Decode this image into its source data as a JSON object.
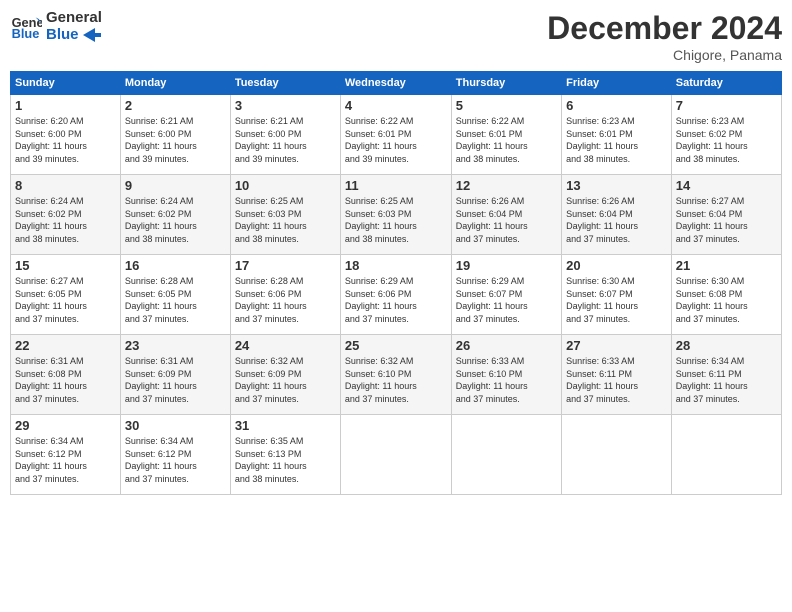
{
  "header": {
    "logo_line1": "General",
    "logo_line2": "Blue",
    "month": "December 2024",
    "location": "Chigore, Panama"
  },
  "days_of_week": [
    "Sunday",
    "Monday",
    "Tuesday",
    "Wednesday",
    "Thursday",
    "Friday",
    "Saturday"
  ],
  "weeks": [
    [
      {
        "day": "1",
        "sunrise": "6:20 AM",
        "sunset": "6:00 PM",
        "daylight": "11 hours and 39 minutes."
      },
      {
        "day": "2",
        "sunrise": "6:21 AM",
        "sunset": "6:00 PM",
        "daylight": "11 hours and 39 minutes."
      },
      {
        "day": "3",
        "sunrise": "6:21 AM",
        "sunset": "6:00 PM",
        "daylight": "11 hours and 39 minutes."
      },
      {
        "day": "4",
        "sunrise": "6:22 AM",
        "sunset": "6:01 PM",
        "daylight": "11 hours and 39 minutes."
      },
      {
        "day": "5",
        "sunrise": "6:22 AM",
        "sunset": "6:01 PM",
        "daylight": "11 hours and 38 minutes."
      },
      {
        "day": "6",
        "sunrise": "6:23 AM",
        "sunset": "6:01 PM",
        "daylight": "11 hours and 38 minutes."
      },
      {
        "day": "7",
        "sunrise": "6:23 AM",
        "sunset": "6:02 PM",
        "daylight": "11 hours and 38 minutes."
      }
    ],
    [
      {
        "day": "8",
        "sunrise": "6:24 AM",
        "sunset": "6:02 PM",
        "daylight": "11 hours and 38 minutes."
      },
      {
        "day": "9",
        "sunrise": "6:24 AM",
        "sunset": "6:02 PM",
        "daylight": "11 hours and 38 minutes."
      },
      {
        "day": "10",
        "sunrise": "6:25 AM",
        "sunset": "6:03 PM",
        "daylight": "11 hours and 38 minutes."
      },
      {
        "day": "11",
        "sunrise": "6:25 AM",
        "sunset": "6:03 PM",
        "daylight": "11 hours and 38 minutes."
      },
      {
        "day": "12",
        "sunrise": "6:26 AM",
        "sunset": "6:04 PM",
        "daylight": "11 hours and 37 minutes."
      },
      {
        "day": "13",
        "sunrise": "6:26 AM",
        "sunset": "6:04 PM",
        "daylight": "11 hours and 37 minutes."
      },
      {
        "day": "14",
        "sunrise": "6:27 AM",
        "sunset": "6:04 PM",
        "daylight": "11 hours and 37 minutes."
      }
    ],
    [
      {
        "day": "15",
        "sunrise": "6:27 AM",
        "sunset": "6:05 PM",
        "daylight": "11 hours and 37 minutes."
      },
      {
        "day": "16",
        "sunrise": "6:28 AM",
        "sunset": "6:05 PM",
        "daylight": "11 hours and 37 minutes."
      },
      {
        "day": "17",
        "sunrise": "6:28 AM",
        "sunset": "6:06 PM",
        "daylight": "11 hours and 37 minutes."
      },
      {
        "day": "18",
        "sunrise": "6:29 AM",
        "sunset": "6:06 PM",
        "daylight": "11 hours and 37 minutes."
      },
      {
        "day": "19",
        "sunrise": "6:29 AM",
        "sunset": "6:07 PM",
        "daylight": "11 hours and 37 minutes."
      },
      {
        "day": "20",
        "sunrise": "6:30 AM",
        "sunset": "6:07 PM",
        "daylight": "11 hours and 37 minutes."
      },
      {
        "day": "21",
        "sunrise": "6:30 AM",
        "sunset": "6:08 PM",
        "daylight": "11 hours and 37 minutes."
      }
    ],
    [
      {
        "day": "22",
        "sunrise": "6:31 AM",
        "sunset": "6:08 PM",
        "daylight": "11 hours and 37 minutes."
      },
      {
        "day": "23",
        "sunrise": "6:31 AM",
        "sunset": "6:09 PM",
        "daylight": "11 hours and 37 minutes."
      },
      {
        "day": "24",
        "sunrise": "6:32 AM",
        "sunset": "6:09 PM",
        "daylight": "11 hours and 37 minutes."
      },
      {
        "day": "25",
        "sunrise": "6:32 AM",
        "sunset": "6:10 PM",
        "daylight": "11 hours and 37 minutes."
      },
      {
        "day": "26",
        "sunrise": "6:33 AM",
        "sunset": "6:10 PM",
        "daylight": "11 hours and 37 minutes."
      },
      {
        "day": "27",
        "sunrise": "6:33 AM",
        "sunset": "6:11 PM",
        "daylight": "11 hours and 37 minutes."
      },
      {
        "day": "28",
        "sunrise": "6:34 AM",
        "sunset": "6:11 PM",
        "daylight": "11 hours and 37 minutes."
      }
    ],
    [
      {
        "day": "29",
        "sunrise": "6:34 AM",
        "sunset": "6:12 PM",
        "daylight": "11 hours and 37 minutes."
      },
      {
        "day": "30",
        "sunrise": "6:34 AM",
        "sunset": "6:12 PM",
        "daylight": "11 hours and 37 minutes."
      },
      {
        "day": "31",
        "sunrise": "6:35 AM",
        "sunset": "6:13 PM",
        "daylight": "11 hours and 38 minutes."
      },
      null,
      null,
      null,
      null
    ]
  ]
}
